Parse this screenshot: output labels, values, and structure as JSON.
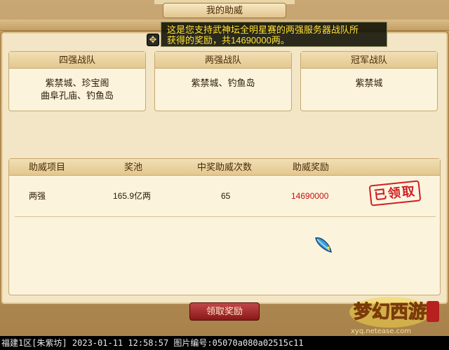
{
  "window": {
    "title": "我的助威"
  },
  "tooltip": {
    "line1": "这是您支持武神坛全明星赛的两强服务器战队所",
    "line2": "获得的奖励，共14690000两。"
  },
  "teams": [
    {
      "header": "四强战队",
      "members": "紫禁城、珍宝阁\n曲阜孔庙、钓鱼岛"
    },
    {
      "header": "两强战队",
      "members": "紫禁城、钓鱼岛"
    },
    {
      "header": "冠军战队",
      "members": "紫禁城"
    }
  ],
  "table": {
    "columns": [
      "助威项目",
      "奖池",
      "中奖助威次数",
      "助威奖励"
    ],
    "rows": [
      {
        "item": "两强",
        "pool": "165.9亿两",
        "wins": "65",
        "reward": "14690000",
        "status": "已领取"
      }
    ]
  },
  "buttons": {
    "claim": "领取奖励"
  },
  "logo": {
    "site": "xyq.netease.com"
  },
  "status_bar": {
    "text": "福建1区[朱紫坊] 2023-01-11 12:58:57 图片编号:05070a080a02515c11"
  },
  "icons": {
    "move": "move-arrows-icon",
    "feather": "feather-icon"
  }
}
